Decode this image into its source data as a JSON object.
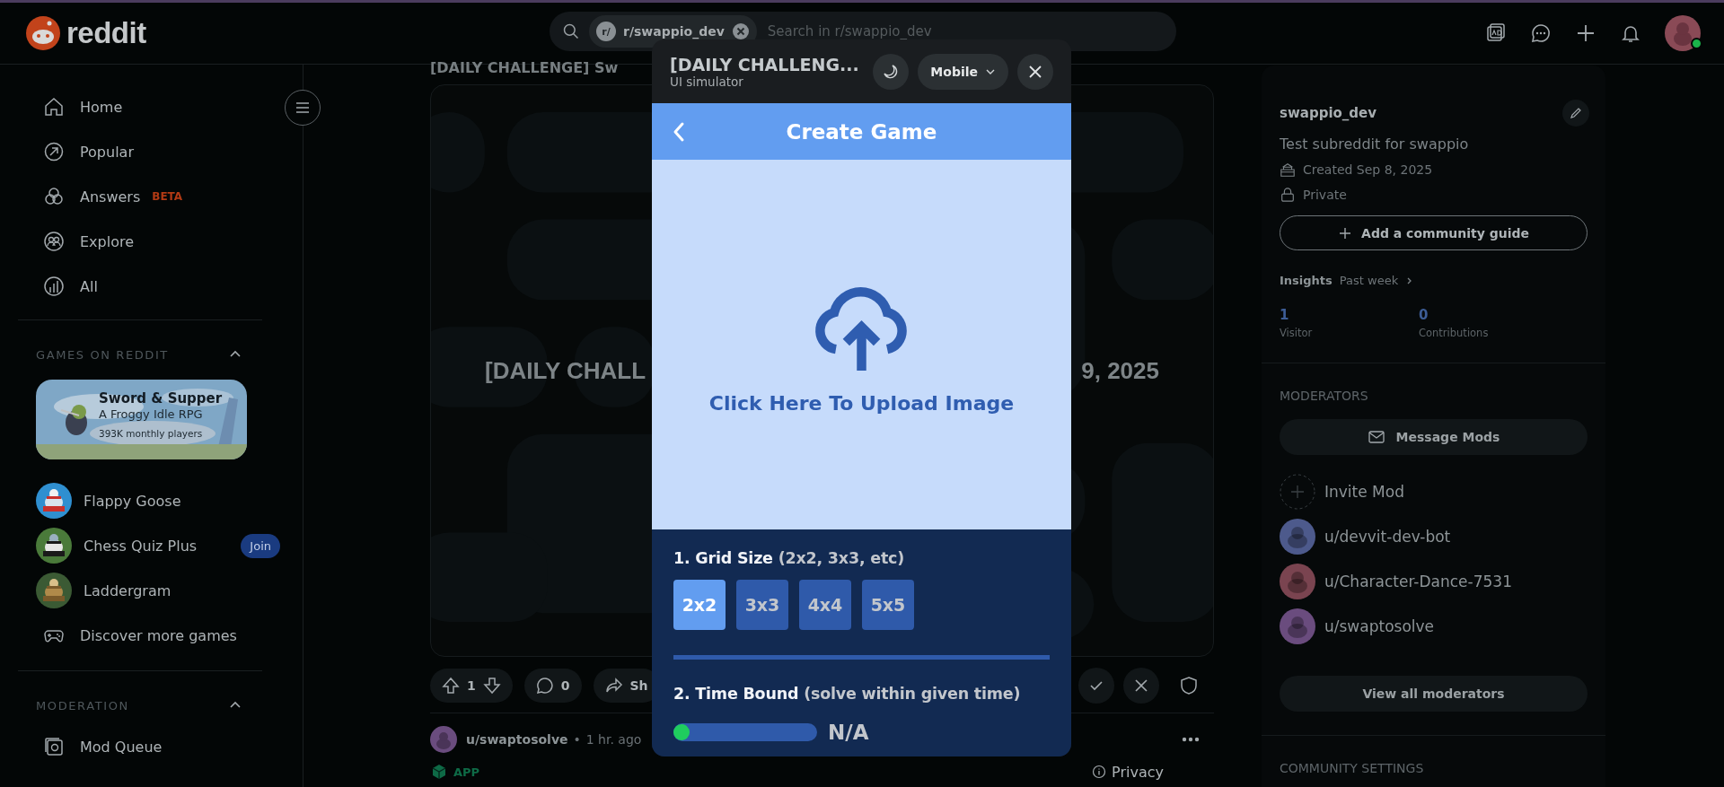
{
  "header": {
    "logo": "reddit",
    "search": {
      "chip_icon": "r/",
      "chip": "r/swappio_dev",
      "placeholder": "Search in r/swappio_dev"
    },
    "user_online": true
  },
  "sidebar": {
    "nav": [
      {
        "label": "Home"
      },
      {
        "label": "Popular"
      },
      {
        "label": "Answers",
        "badge": "BETA"
      },
      {
        "label": "Explore"
      },
      {
        "label": "All"
      }
    ],
    "games": {
      "title": "GAMES ON REDDIT",
      "expanded": true,
      "featured": {
        "title": "Sword & Supper",
        "subtitle": "A Froggy Idle RPG",
        "players": "393K monthly players"
      },
      "items": [
        {
          "kind": "game",
          "label": "Flappy Goose"
        },
        {
          "kind": "game",
          "label": "Chess Quiz Plus",
          "action": "Join"
        },
        {
          "kind": "game",
          "label": "Laddergram"
        },
        {
          "kind": "link",
          "label": "Discover more games"
        }
      ]
    },
    "moderation": {
      "title": "MODERATION",
      "expanded": true,
      "items": [
        {
          "label": "Mod Queue"
        }
      ]
    }
  },
  "post": {
    "title": "[DAILY CHALLENGE] Sw",
    "media_text_left": "[DAILY CHALL",
    "media_text_right": "9, 2025",
    "votes": "1",
    "comments": "0",
    "share": "Sh",
    "author": "u/swaptosolve",
    "separator": "•",
    "time": "1 hr. ago",
    "app_label": "APP",
    "privacy": "Privacy"
  },
  "community": {
    "name": "swappio_dev",
    "description": "Test subreddit for swappio",
    "created": "Created Sep 8, 2025",
    "visibility": "Private",
    "guide_button": "Add a community guide",
    "insights": "Insights",
    "period": "Past week",
    "stats": [
      {
        "value": "1",
        "label": "Visitor"
      },
      {
        "value": "0",
        "label": "Contributions"
      }
    ],
    "moderators_title": "MODERATORS",
    "message_button": "Message Mods",
    "invite": "Invite Mod",
    "moderators": [
      {
        "name": "u/devvit-dev-bot",
        "color": "#4d5a8c"
      },
      {
        "name": "u/Character-Dance-7531",
        "color": "#7a4450"
      },
      {
        "name": "u/swaptosolve",
        "color": "#6a4c7e"
      }
    ],
    "view_all": "View all moderators",
    "settings_title": "COMMUNITY SETTINGS"
  },
  "simulator": {
    "title": "[DAILY CHALLENG...",
    "subtitle": "UI simulator",
    "device": "Mobile",
    "app": {
      "header": "Create Game",
      "upload_label": "Click Here To Upload Image",
      "grid_size": {
        "label": "1. Grid Size",
        "hint": "(2x2, 3x3, etc)",
        "options": [
          {
            "label": "2x2",
            "selected": true
          },
          {
            "label": "3x3",
            "selected": false
          },
          {
            "label": "4x4",
            "selected": false
          },
          {
            "label": "5x5",
            "selected": false
          }
        ]
      },
      "time_bound": {
        "label": "2. Time Bound",
        "hint": "(solve within given time)",
        "level": 0,
        "reading": "N/A"
      }
    }
  }
}
